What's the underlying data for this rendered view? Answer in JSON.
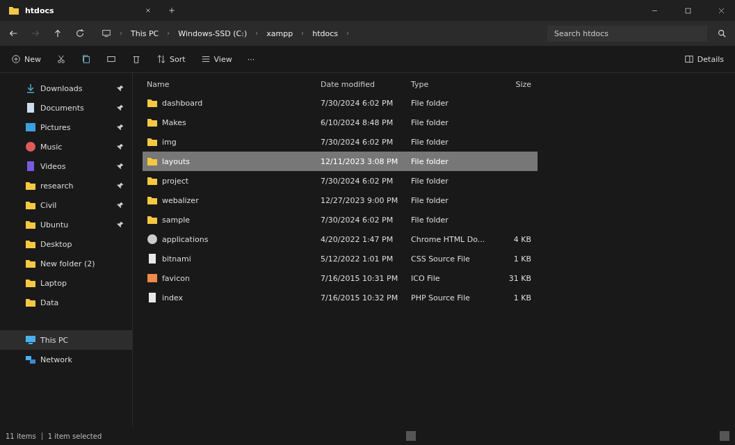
{
  "window": {
    "title": "htdocs"
  },
  "address": {
    "crumbs": [
      "This PC",
      "Windows-SSD (C:)",
      "xampp",
      "htdocs"
    ]
  },
  "search": {
    "placeholder": "Search htdocs"
  },
  "toolbar": {
    "new": "New",
    "sort": "Sort",
    "view": "View",
    "more": "···",
    "details": "Details"
  },
  "sidebar": {
    "items": [
      {
        "label": "Downloads",
        "kind": "download",
        "pinned": true,
        "selected": false
      },
      {
        "label": "Documents",
        "kind": "document",
        "pinned": true,
        "selected": false
      },
      {
        "label": "Pictures",
        "kind": "picture",
        "pinned": true,
        "selected": false
      },
      {
        "label": "Music",
        "kind": "music",
        "pinned": true,
        "selected": false
      },
      {
        "label": "Videos",
        "kind": "video",
        "pinned": true,
        "selected": false
      },
      {
        "label": "research",
        "kind": "folder",
        "pinned": true,
        "selected": false
      },
      {
        "label": "Civil",
        "kind": "folder",
        "pinned": true,
        "selected": false
      },
      {
        "label": "Ubuntu",
        "kind": "folder",
        "pinned": true,
        "selected": false
      },
      {
        "label": "Desktop",
        "kind": "folder",
        "pinned": false,
        "selected": false
      },
      {
        "label": "New folder (2)",
        "kind": "folder",
        "pinned": false,
        "selected": false
      },
      {
        "label": "Laptop",
        "kind": "folder",
        "pinned": false,
        "selected": false
      },
      {
        "label": "Data",
        "kind": "folder",
        "pinned": false,
        "selected": false
      },
      {
        "label": "This PC",
        "kind": "pc",
        "pinned": false,
        "selected": true
      },
      {
        "label": "Network",
        "kind": "network",
        "pinned": false,
        "selected": false
      }
    ]
  },
  "table": {
    "columns": [
      "Name",
      "Date modified",
      "Type",
      "Size"
    ],
    "rows": [
      {
        "kind": "folder",
        "name": "dashboard",
        "date": "7/30/2024 6:02 PM",
        "type": "File folder",
        "selected": false
      },
      {
        "kind": "folder",
        "name": "Makes",
        "date": "6/10/2024 8:48 PM",
        "type": "File folder",
        "selected": false
      },
      {
        "kind": "folder",
        "name": "img",
        "date": "7/30/2024 6:02 PM",
        "type": "File folder",
        "selected": false
      },
      {
        "kind": "folder",
        "name": "layouts",
        "date": "12/11/2023 3:08 PM",
        "type": "File folder",
        "selected": true
      },
      {
        "kind": "folder",
        "name": "project",
        "date": "7/30/2024 6:02 PM",
        "type": "File folder",
        "selected": false
      },
      {
        "kind": "folder",
        "name": "webalizer",
        "date": "12/27/2023 9:00 PM",
        "type": "File folder",
        "selected": false
      },
      {
        "kind": "folder",
        "name": "sample",
        "date": "7/30/2024 6:02 PM",
        "type": "File folder",
        "selected": false
      },
      {
        "kind": "web",
        "name": "applications",
        "date": "4/20/2022 1:47 PM",
        "type": "Chrome HTML Do...",
        "size": "4 KB",
        "selected": false
      },
      {
        "kind": "file",
        "name": "bitnami",
        "date": "5/12/2022 1:01 PM",
        "type": "CSS Source File",
        "size": "1 KB",
        "selected": false
      },
      {
        "kind": "image",
        "name": "favicon",
        "date": "7/16/2015 10:31 PM",
        "type": "ICO File",
        "size": "31 KB",
        "selected": false
      },
      {
        "kind": "file",
        "name": "index",
        "date": "7/16/2015 10:32 PM",
        "type": "PHP Source File",
        "size": "1 KB",
        "selected": false
      }
    ]
  },
  "status_bar": {
    "count": "11 items",
    "selection": "1 item selected"
  }
}
